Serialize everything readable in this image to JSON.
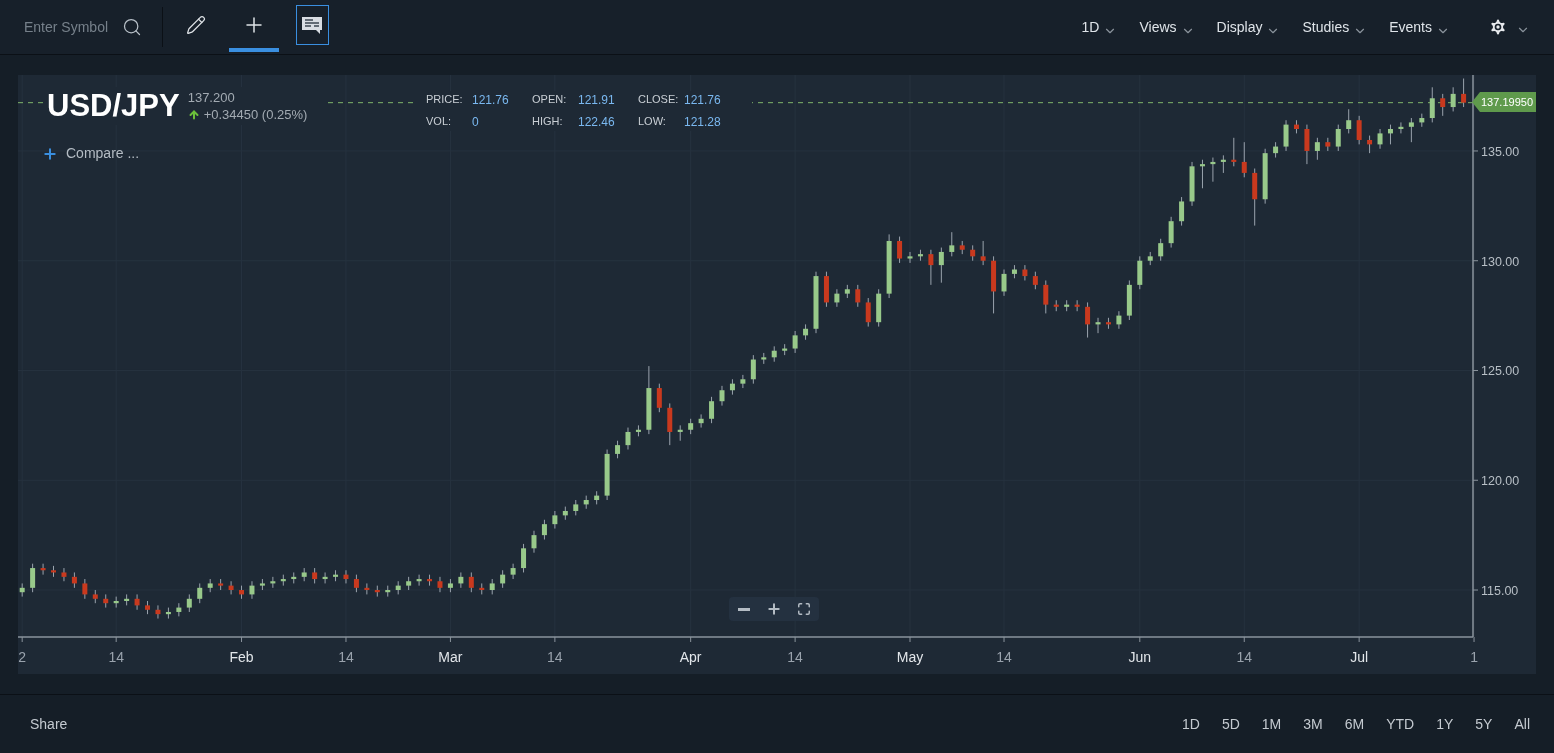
{
  "toolbar": {
    "search": {
      "placeholder": "Enter Symbol"
    },
    "tools": [
      {
        "kind": "draw",
        "selected": false,
        "toggled": false
      },
      {
        "kind": "crosshair",
        "selected": true,
        "toggled": false
      },
      {
        "kind": "comments",
        "selected": false,
        "toggled": true
      }
    ],
    "menus": [
      {
        "label": "1D"
      },
      {
        "label": "Views"
      },
      {
        "label": "Display"
      },
      {
        "label": "Studies"
      },
      {
        "label": "Events"
      }
    ]
  },
  "chart": {
    "symbol": "USD/JPY",
    "last": "137.200",
    "change": "+0.34450 (0.25%)",
    "rising": true,
    "compare": "Compare ...",
    "stats": [
      {
        "label": "PRICE:",
        "value": "121.76"
      },
      {
        "label": "OPEN:",
        "value": "121.91"
      },
      {
        "label": "CLOSE:",
        "value": "121.76"
      },
      {
        "label": "VOL:",
        "value": "0"
      },
      {
        "label": "HIGH:",
        "value": "122.46"
      },
      {
        "label": "LOW:",
        "value": "121.28"
      }
    ],
    "chart_data": {
      "type": "candlestick",
      "grid": true,
      "ref_lines": [
        {
          "axis": "y",
          "value": 137.1995,
          "label": "137.19950"
        }
      ],
      "ylim": [
        112.86,
        138.46
      ],
      "categories": [
        "2",
        null,
        null,
        null,
        null,
        null,
        null,
        null,
        null,
        "14",
        null,
        null,
        null,
        null,
        null,
        null,
        null,
        null,
        null,
        null,
        null,
        "Feb",
        null,
        null,
        null,
        null,
        null,
        null,
        null,
        null,
        null,
        "14",
        null,
        null,
        null,
        null,
        null,
        null,
        null,
        null,
        null,
        "Mar",
        null,
        null,
        null,
        null,
        null,
        null,
        null,
        null,
        null,
        "14",
        null,
        null,
        null,
        null,
        null,
        null,
        null,
        null,
        null,
        null,
        null,
        null,
        "Apr",
        null,
        null,
        null,
        null,
        null,
        null,
        null,
        null,
        null,
        "14",
        null,
        null,
        null,
        null,
        null,
        null,
        null,
        null,
        null,
        null,
        "May",
        null,
        null,
        null,
        null,
        null,
        null,
        null,
        null,
        "14",
        null,
        null,
        null,
        null,
        null,
        null,
        null,
        null,
        null,
        null,
        null,
        null,
        "Jun",
        null,
        null,
        null,
        null,
        null,
        null,
        null,
        null,
        null,
        "14",
        null,
        null,
        null,
        null,
        null,
        null,
        null,
        null,
        null,
        null,
        "Jul",
        null,
        null,
        null,
        null,
        null,
        null,
        null,
        null,
        null,
        null,
        "1"
      ],
      "yticks": [
        {
          "value": 115,
          "label": "115.00"
        },
        {
          "value": 120,
          "label": "120.00"
        },
        {
          "value": 125,
          "label": "125.00"
        },
        {
          "value": 130,
          "label": "130.00"
        },
        {
          "value": 135,
          "label": "135.00"
        }
      ],
      "ohlc": [
        [
          114.9,
          115.3,
          114.7,
          115.1
        ],
        [
          115.1,
          116.2,
          114.9,
          116.0
        ],
        [
          116.0,
          116.2,
          115.7,
          115.9
        ],
        [
          115.9,
          116.1,
          115.6,
          115.8
        ],
        [
          115.8,
          116.0,
          115.4,
          115.6
        ],
        [
          115.6,
          115.8,
          115.1,
          115.3
        ],
        [
          115.3,
          115.5,
          114.6,
          114.8
        ],
        [
          114.8,
          115.0,
          114.4,
          114.6
        ],
        [
          114.6,
          114.8,
          114.2,
          114.4
        ],
        [
          114.4,
          114.7,
          114.2,
          114.5
        ],
        [
          114.5,
          114.8,
          114.3,
          114.6
        ],
        [
          114.6,
          114.8,
          114.1,
          114.3
        ],
        [
          114.3,
          114.5,
          113.9,
          114.1
        ],
        [
          114.1,
          114.3,
          113.7,
          113.9
        ],
        [
          113.9,
          114.2,
          113.7,
          114.0
        ],
        [
          114.0,
          114.4,
          113.8,
          114.2
        ],
        [
          114.2,
          114.8,
          114.0,
          114.6
        ],
        [
          114.6,
          115.3,
          114.4,
          115.1
        ],
        [
          115.1,
          115.5,
          114.9,
          115.3
        ],
        [
          115.3,
          115.5,
          115.0,
          115.2
        ],
        [
          115.2,
          115.4,
          114.8,
          115.0
        ],
        [
          115.0,
          115.2,
          114.6,
          114.8
        ],
        [
          114.8,
          115.4,
          114.6,
          115.2
        ],
        [
          115.2,
          115.5,
          115.0,
          115.3
        ],
        [
          115.3,
          115.6,
          115.1,
          115.4
        ],
        [
          115.4,
          115.7,
          115.2,
          115.5
        ],
        [
          115.5,
          115.8,
          115.3,
          115.6
        ],
        [
          115.6,
          116.0,
          115.4,
          115.8
        ],
        [
          115.8,
          116.0,
          115.3,
          115.5
        ],
        [
          115.5,
          115.8,
          115.3,
          115.6
        ],
        [
          115.6,
          115.9,
          115.4,
          115.7
        ],
        [
          115.7,
          115.9,
          115.3,
          115.5
        ],
        [
          115.5,
          115.7,
          114.9,
          115.1
        ],
        [
          115.1,
          115.3,
          114.8,
          115.0
        ],
        [
          115.0,
          115.2,
          114.7,
          114.9
        ],
        [
          114.9,
          115.2,
          114.7,
          115.0
        ],
        [
          115.0,
          115.4,
          114.8,
          115.2
        ],
        [
          115.2,
          115.6,
          115.0,
          115.4
        ],
        [
          115.4,
          115.7,
          115.2,
          115.5
        ],
        [
          115.5,
          115.7,
          115.2,
          115.4
        ],
        [
          115.4,
          115.6,
          114.9,
          115.1
        ],
        [
          115.1,
          115.5,
          114.9,
          115.3
        ],
        [
          115.3,
          115.8,
          115.1,
          115.6
        ],
        [
          115.6,
          115.8,
          114.9,
          115.1
        ],
        [
          115.1,
          115.3,
          114.8,
          115.0
        ],
        [
          115.0,
          115.5,
          114.8,
          115.3
        ],
        [
          115.3,
          115.9,
          115.1,
          115.7
        ],
        [
          115.7,
          116.2,
          115.5,
          116.0
        ],
        [
          116.0,
          117.1,
          115.8,
          116.9
        ],
        [
          116.9,
          117.7,
          116.7,
          117.5
        ],
        [
          117.5,
          118.2,
          117.3,
          118.0
        ],
        [
          118.0,
          118.6,
          117.8,
          118.4
        ],
        [
          118.4,
          118.8,
          118.2,
          118.6
        ],
        [
          118.6,
          119.1,
          118.4,
          118.9
        ],
        [
          118.9,
          119.3,
          118.7,
          119.1
        ],
        [
          119.1,
          119.5,
          118.9,
          119.3
        ],
        [
          119.3,
          121.4,
          119.1,
          121.2
        ],
        [
          121.2,
          121.8,
          121.0,
          121.6
        ],
        [
          121.6,
          122.4,
          121.4,
          122.2
        ],
        [
          122.2,
          122.5,
          122.0,
          122.3
        ],
        [
          122.3,
          125.2,
          122.1,
          124.2
        ],
        [
          124.2,
          124.4,
          123.1,
          123.3
        ],
        [
          123.3,
          123.5,
          121.6,
          122.2
        ],
        [
          122.2,
          122.5,
          121.8,
          122.3
        ],
        [
          122.3,
          122.8,
          122.1,
          122.6
        ],
        [
          122.6,
          123.0,
          122.4,
          122.8
        ],
        [
          122.8,
          123.8,
          122.6,
          123.6
        ],
        [
          123.6,
          124.3,
          123.4,
          124.1
        ],
        [
          124.1,
          124.6,
          123.9,
          124.4
        ],
        [
          124.4,
          124.8,
          124.2,
          124.6
        ],
        [
          124.6,
          125.7,
          124.4,
          125.5
        ],
        [
          125.5,
          125.8,
          125.3,
          125.6
        ],
        [
          125.6,
          126.1,
          125.4,
          125.9
        ],
        [
          125.9,
          126.2,
          125.7,
          126.0
        ],
        [
          126.0,
          126.8,
          125.8,
          126.6
        ],
        [
          126.6,
          127.1,
          126.4,
          126.9
        ],
        [
          126.9,
          129.5,
          126.7,
          129.3
        ],
        [
          129.3,
          129.5,
          127.9,
          128.1
        ],
        [
          128.1,
          128.7,
          127.9,
          128.5
        ],
        [
          128.5,
          128.9,
          128.3,
          128.7
        ],
        [
          128.7,
          128.9,
          127.9,
          128.1
        ],
        [
          128.1,
          128.3,
          127.0,
          127.2
        ],
        [
          127.2,
          128.7,
          127.0,
          128.5
        ],
        [
          128.5,
          131.2,
          128.3,
          130.9
        ],
        [
          130.9,
          131.1,
          129.9,
          130.1
        ],
        [
          130.1,
          130.4,
          129.9,
          130.2
        ],
        [
          130.2,
          130.5,
          130.0,
          130.3
        ],
        [
          130.3,
          130.5,
          128.9,
          129.8
        ],
        [
          129.8,
          130.6,
          129.0,
          130.4
        ],
        [
          130.4,
          131.3,
          130.2,
          130.7
        ],
        [
          130.7,
          130.9,
          130.3,
          130.5
        ],
        [
          130.5,
          130.7,
          130.0,
          130.2
        ],
        [
          130.2,
          130.9,
          129.8,
          130.0
        ],
        [
          130.0,
          130.2,
          127.6,
          128.6
        ],
        [
          128.6,
          129.6,
          128.4,
          129.4
        ],
        [
          129.4,
          129.8,
          129.2,
          129.6
        ],
        [
          129.6,
          129.8,
          129.1,
          129.3
        ],
        [
          129.3,
          129.5,
          128.7,
          128.9
        ],
        [
          128.9,
          129.1,
          127.6,
          128.0
        ],
        [
          128.0,
          128.2,
          127.7,
          127.9
        ],
        [
          127.9,
          128.2,
          127.7,
          128.0
        ],
        [
          128.0,
          128.2,
          127.7,
          127.9
        ],
        [
          127.9,
          128.1,
          126.5,
          127.1
        ],
        [
          127.1,
          127.4,
          126.7,
          127.2
        ],
        [
          127.2,
          127.4,
          126.9,
          127.1
        ],
        [
          127.1,
          127.7,
          126.9,
          127.5
        ],
        [
          127.5,
          129.1,
          127.3,
          128.9
        ],
        [
          128.9,
          130.2,
          128.7,
          130.0
        ],
        [
          130.0,
          130.4,
          129.8,
          130.2
        ],
        [
          130.2,
          131.0,
          130.0,
          130.8
        ],
        [
          130.8,
          132.0,
          130.6,
          131.8
        ],
        [
          131.8,
          132.9,
          131.6,
          132.7
        ],
        [
          132.7,
          134.5,
          132.5,
          134.3
        ],
        [
          134.3,
          134.6,
          133.3,
          134.4
        ],
        [
          134.4,
          134.7,
          133.6,
          134.5
        ],
        [
          134.5,
          134.8,
          134.0,
          134.6
        ],
        [
          134.6,
          135.6,
          134.3,
          134.5
        ],
        [
          134.5,
          135.4,
          133.8,
          134.0
        ],
        [
          134.0,
          134.2,
          131.6,
          132.8
        ],
        [
          132.8,
          135.1,
          132.6,
          134.9
        ],
        [
          134.9,
          135.4,
          134.7,
          135.2
        ],
        [
          135.2,
          136.4,
          135.0,
          136.2
        ],
        [
          136.2,
          136.4,
          135.8,
          136.0
        ],
        [
          136.0,
          136.2,
          134.4,
          135.0
        ],
        [
          135.0,
          135.6,
          134.6,
          135.4
        ],
        [
          135.4,
          135.6,
          135.0,
          135.2
        ],
        [
          135.2,
          136.2,
          135.0,
          136.0
        ],
        [
          136.0,
          136.9,
          135.8,
          136.4
        ],
        [
          136.4,
          136.6,
          135.3,
          135.5
        ],
        [
          135.5,
          135.7,
          134.9,
          135.3
        ],
        [
          135.3,
          136.0,
          135.1,
          135.8
        ],
        [
          135.8,
          136.2,
          135.3,
          136.0
        ],
        [
          136.0,
          136.3,
          135.8,
          136.1
        ],
        [
          136.1,
          136.5,
          135.4,
          136.3
        ],
        [
          136.3,
          136.7,
          136.1,
          136.5
        ],
        [
          136.5,
          137.9,
          136.3,
          137.4
        ],
        [
          137.4,
          137.6,
          136.6,
          137.0
        ],
        [
          137.0,
          137.9,
          136.8,
          137.6
        ],
        [
          137.6,
          138.3,
          137.0,
          137.2
        ],
        null
      ]
    }
  },
  "footer": {
    "share": "Share",
    "ranges": [
      {
        "label": "1D"
      },
      {
        "label": "5D"
      },
      {
        "label": "1M"
      },
      {
        "label": "3M"
      },
      {
        "label": "6M"
      },
      {
        "label": "YTD"
      },
      {
        "label": "1Y"
      },
      {
        "label": "5Y"
      },
      {
        "label": "All"
      }
    ]
  }
}
